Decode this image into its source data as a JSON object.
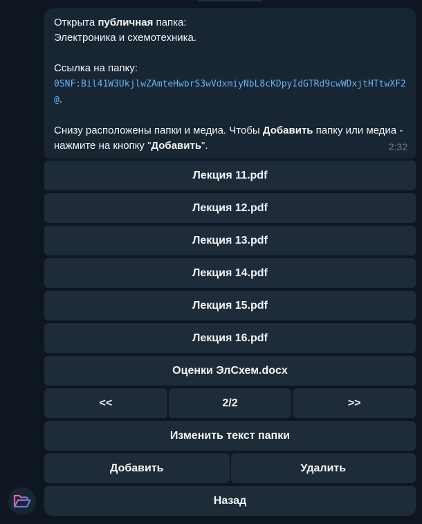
{
  "message": {
    "line1_pre": "Открыта ",
    "line1_bold": "публичная",
    "line1_post": " папка:",
    "line2": "Электроника и схемотехника.",
    "link_label": "Ссылка на папку:",
    "link_code": "0SNF:Bil41W3UkjlwZAmteHwbrS3wVdxmiyNbL8cKDpyIdGTRd9cwWDxjtHTtwXF2@",
    "link_suffix": ".",
    "info_pre": "Снизу расположены папки и медиа. Чтобы ",
    "info_bold1": "Добавить",
    "info_mid": " папку или медиа - нажмите на кнопку \"",
    "info_bold2": "Добавить",
    "info_post": "\".",
    "time": "2:32"
  },
  "keyboard": {
    "files": [
      "Лекция 11.pdf",
      "Лекция 12.pdf",
      "Лекция 13.pdf",
      "Лекция 14.pdf",
      "Лекция 15.pdf",
      "Лекция 16.pdf",
      "Оценки ЭлСхем.docx"
    ],
    "nav_prev": "<<",
    "nav_page": "2/2",
    "nav_next": ">>",
    "edit_text": "Изменить текст папки",
    "add": "Добавить",
    "delete": "Удалить",
    "back": "Назад"
  },
  "avatar": {
    "icon": "folder-open-icon",
    "accent_start": "#ff5fa2",
    "accent_end": "#3b82f6"
  }
}
